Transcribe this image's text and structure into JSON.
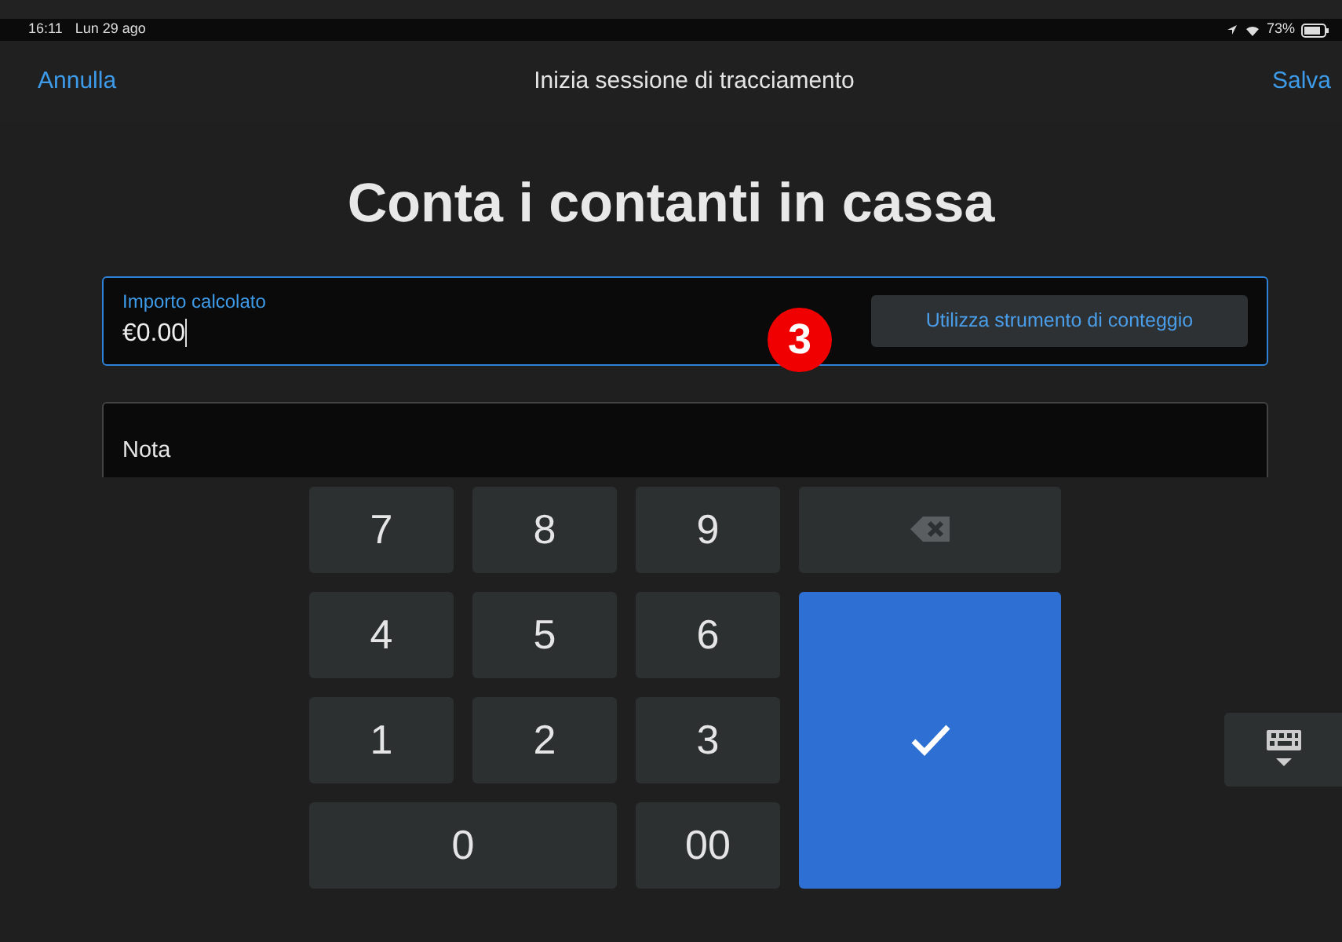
{
  "status_bar": {
    "time": "16:11",
    "date": "Lun 29 ago",
    "battery": "73%"
  },
  "nav": {
    "cancel": "Annulla",
    "title": "Inizia sessione di tracciamento",
    "save": "Salva"
  },
  "heading": "Conta i contanti in cassa",
  "amount_field": {
    "label": "Importo calcolato",
    "value": "€0.00",
    "focused": true
  },
  "count_button": "Utilizza strumento di conteggio",
  "annotation_badge": "3",
  "note": {
    "label": "Nota"
  },
  "keypad": [
    {
      "kind": "digit",
      "label": "7"
    },
    {
      "kind": "digit",
      "label": "8"
    },
    {
      "kind": "digit",
      "label": "9"
    },
    {
      "kind": "backspace"
    },
    {
      "kind": "digit",
      "label": "4"
    },
    {
      "kind": "digit",
      "label": "5"
    },
    {
      "kind": "digit",
      "label": "6"
    },
    {
      "kind": "confirm"
    },
    {
      "kind": "digit",
      "label": "1"
    },
    {
      "kind": "digit",
      "label": "2"
    },
    {
      "kind": "digit",
      "label": "3"
    },
    {
      "kind": "wide_digit",
      "label": "0"
    },
    {
      "kind": "digit",
      "label": "00"
    }
  ]
}
